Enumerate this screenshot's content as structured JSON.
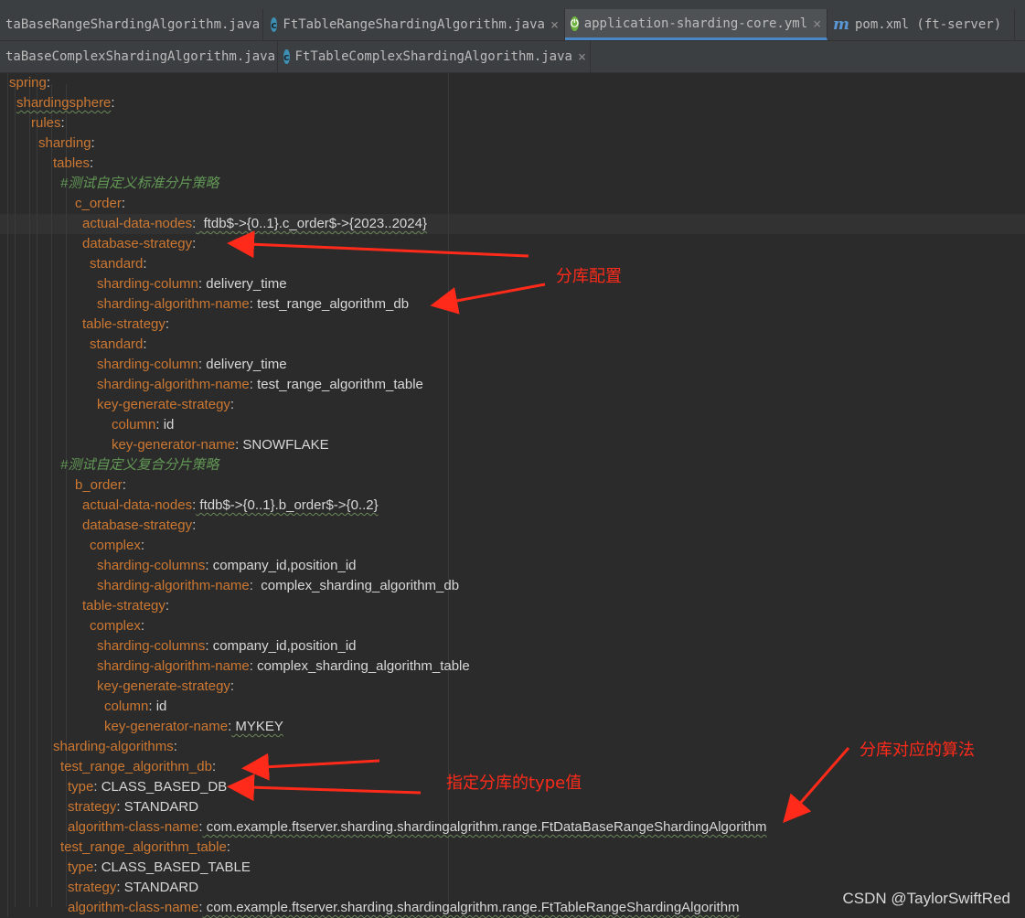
{
  "tabs_row1": [
    {
      "label": "taBaseRangeShardingAlgorithm.java",
      "icon": "c-class-icon",
      "active": false
    },
    {
      "label": "FtTableRangeShardingAlgorithm.java",
      "icon": "c-class-icon",
      "active": false
    },
    {
      "label": "application-sharding-core.yml",
      "icon": "spring-icon",
      "active": true
    },
    {
      "label": "pom.xml (ft-server)",
      "icon": "maven-icon",
      "active": false
    }
  ],
  "tabs_row2": [
    {
      "label": "taBaseComplexShardingAlgorithm.java",
      "icon": "c-class-icon"
    },
    {
      "label": "FtTableComplexShardingAlgorithm.java",
      "icon": "c-class-icon"
    }
  ],
  "close_glyph": "×",
  "code": [
    {
      "key": "spring",
      "sep": ":",
      "val": ""
    },
    {
      "key": "shardingsphere",
      "sep": ":",
      "val": ""
    },
    {
      "key": "rules",
      "sep": ":",
      "val": ""
    },
    {
      "key": "sharding",
      "sep": ":",
      "val": ""
    },
    {
      "key": "tables",
      "sep": ":",
      "val": ""
    },
    {
      "comment": "#测试自定义标准分片策略"
    },
    {
      "key": "c_order",
      "sep": ":",
      "val": ""
    },
    {
      "key": "actual-data-nodes",
      "sep": ":",
      "val": "  ftdb$->{0..1}.c_order$->{2023..2024}"
    },
    {
      "key": "database-strategy",
      "sep": ":",
      "val": ""
    },
    {
      "key": "standard",
      "sep": ":",
      "val": ""
    },
    {
      "key": "sharding-column",
      "sep": ":",
      "val": " delivery_time"
    },
    {
      "key": "sharding-algorithm-name",
      "sep": ":",
      "val": " test_range_algorithm_db"
    },
    {
      "key": "table-strategy",
      "sep": ":",
      "val": ""
    },
    {
      "key": "standard",
      "sep": ":",
      "val": ""
    },
    {
      "key": "sharding-column",
      "sep": ":",
      "val": " delivery_time"
    },
    {
      "key": "sharding-algorithm-name",
      "sep": ":",
      "val": " test_range_algorithm_table"
    },
    {
      "key": "key-generate-strategy",
      "sep": ":",
      "val": ""
    },
    {
      "key": "column",
      "sep": ":",
      "val": " id"
    },
    {
      "key": "key-generator-name",
      "sep": ":",
      "val": " SNOWFLAKE"
    },
    {
      "comment": "#测试自定义复合分片策略"
    },
    {
      "key": "b_order",
      "sep": ":",
      "val": ""
    },
    {
      "key": "actual-data-nodes",
      "sep": ":",
      "val": " ftdb$->{0..1}.b_order$->{0..2}"
    },
    {
      "key": "database-strategy",
      "sep": ":",
      "val": ""
    },
    {
      "key": "complex",
      "sep": ":",
      "val": ""
    },
    {
      "key": "sharding-columns",
      "sep": ":",
      "val": " company_id,position_id"
    },
    {
      "key": "sharding-algorithm-name",
      "sep": ":",
      "val": "  complex_sharding_algorithm_db"
    },
    {
      "key": "table-strategy",
      "sep": ":",
      "val": ""
    },
    {
      "key": "complex",
      "sep": ":",
      "val": ""
    },
    {
      "key": "sharding-columns",
      "sep": ":",
      "val": " company_id,position_id"
    },
    {
      "key": "sharding-algorithm-name",
      "sep": ":",
      "val": " complex_sharding_algorithm_table"
    },
    {
      "key": "key-generate-strategy",
      "sep": ":",
      "val": ""
    },
    {
      "key": "column",
      "sep": ":",
      "val": " id"
    },
    {
      "key": "key-generator-name",
      "sep": ":",
      "val": " MYKEY"
    },
    {
      "key": "sharding-algorithms",
      "sep": ":",
      "val": ""
    },
    {
      "key": "test_range_algorithm_db",
      "sep": ":",
      "val": ""
    },
    {
      "key": "type",
      "sep": ":",
      "val": " CLASS_BASED_DB"
    },
    {
      "key": "strategy",
      "sep": ":",
      "val": " STANDARD"
    },
    {
      "key": "algorithm-class-name",
      "sep": ":",
      "val": " com.example.ftserver.sharding.shardingalgrithm.range.FtDataBaseRangeShardingAlgorithm"
    },
    {
      "key": "test_range_algorithm_table",
      "sep": ":",
      "val": ""
    },
    {
      "key": "type",
      "sep": ":",
      "val": " CLASS_BASED_TABLE"
    },
    {
      "key": "strategy",
      "sep": ":",
      "val": " STANDARD"
    },
    {
      "key": "algorithm-class-name",
      "sep": ":",
      "val": " com.example.ftserver.sharding.shardingalgrithm.range.FtTableRangeShardingAlgorithm"
    }
  ],
  "annotations": {
    "db_config": "分库配置",
    "algorithm_for_db": "分库对应的算法",
    "type_value": "指定分库的type值"
  },
  "watermark": "CSDN @TaylorSwiftRed",
  "colors": {
    "key": "#cc7832",
    "comment": "#629755",
    "value": "#d8d8d8",
    "annotation": "#ff2a1a",
    "background": "#2b2b2b"
  }
}
